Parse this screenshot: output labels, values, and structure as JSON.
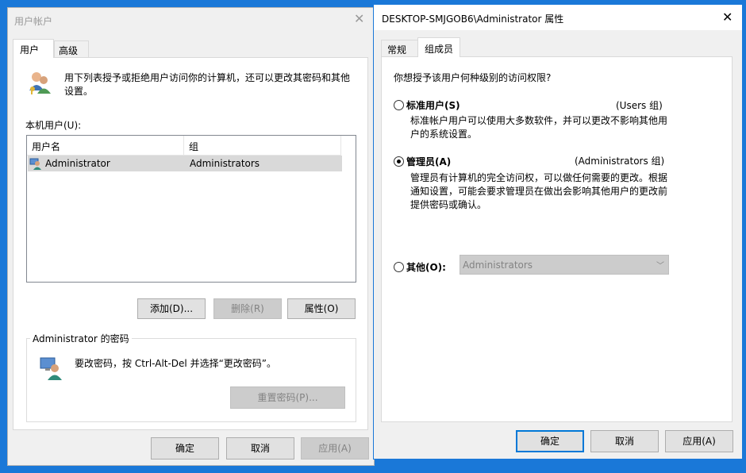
{
  "left_window": {
    "title": "用户帐户",
    "tabs": [
      "用户",
      "高级"
    ],
    "intro_text": "用下列表授予或拒绝用户访问你的计算机，还可以更改其密码和其他设置。",
    "users_label": "本机用户(U):",
    "table": {
      "columns": [
        "用户名",
        "组"
      ],
      "rows": [
        {
          "name": "Administrator",
          "group": "Administrators"
        }
      ]
    },
    "add_button": "添加(D)...",
    "delete_button": "删除(R)",
    "properties_button": "属性(O)",
    "password_group_title": "Administrator 的密码",
    "password_text": "要改密码，按 Ctrl-Alt-Del 并选择“更改密码”。",
    "reset_password_button": "重置密码(P)...",
    "ok_button": "确定",
    "cancel_button": "取消",
    "apply_button": "应用(A)"
  },
  "right_window": {
    "title": "DESKTOP-SMJGOB6\\Administrator 属性",
    "tabs": [
      "常规",
      "组成员"
    ],
    "question": "你想授予该用户何种级别的访问权限?",
    "options": [
      {
        "label": "标准用户(S)",
        "group": "(Users 组)",
        "desc": "标准帐户用户可以使用大多数软件，并可以更改不影响其他用户的系统设置。",
        "checked": false
      },
      {
        "label": "管理员(A)",
        "group": "(Administrators 组)",
        "desc": "管理员有计算机的完全访问权，可以做任何需要的更改。根据通知设置，可能会要求管理员在做出会影响其他用户的更改前提供密码或确认。",
        "checked": true
      }
    ],
    "other_label": "其他(O):",
    "other_select_value": "Administrators",
    "ok_button": "确定",
    "cancel_button": "取消",
    "apply_button": "应用(A)"
  },
  "colors": {
    "desktop": "#1a78d8",
    "accent": "#0078d7",
    "disabled_text": "#838383"
  }
}
